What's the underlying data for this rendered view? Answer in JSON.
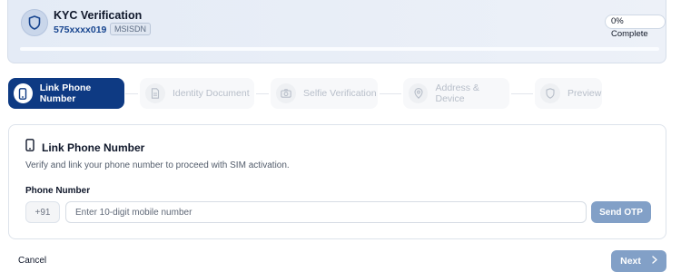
{
  "header": {
    "title": "KYC Verification",
    "phone": "575xxxx019",
    "badge": "MSISDN",
    "completion_text": "0% Complete",
    "progress": 0,
    "icon": "shield-icon"
  },
  "steps": [
    {
      "label": "Link Phone Number",
      "icon": "phone-icon",
      "state": "active"
    },
    {
      "label": "Identity Document",
      "icon": "document-icon",
      "state": "inactive"
    },
    {
      "label": "Selfie Verification",
      "icon": "camera-icon",
      "state": "inactive"
    },
    {
      "label": "Address & Device",
      "icon": "location-pin-icon",
      "state": "inactive"
    },
    {
      "label": "Preview",
      "icon": "shield-icon",
      "state": "inactive"
    }
  ],
  "card": {
    "title": "Link Phone Number",
    "description": "Verify and link your phone number to proceed with SIM activation.",
    "field_label": "Phone Number",
    "prefix": "+91",
    "input_value": "",
    "input_placeholder": "Enter 10-digit mobile number",
    "send_otp_label": "Send OTP"
  },
  "footer": {
    "cancel_label": "Cancel",
    "next_label": "Next"
  },
  "colors": {
    "primary": "#0e3a83",
    "button_disabled": "#82a0c7",
    "header_bg": "#e4ebf6",
    "phone_text": "#17458f"
  }
}
